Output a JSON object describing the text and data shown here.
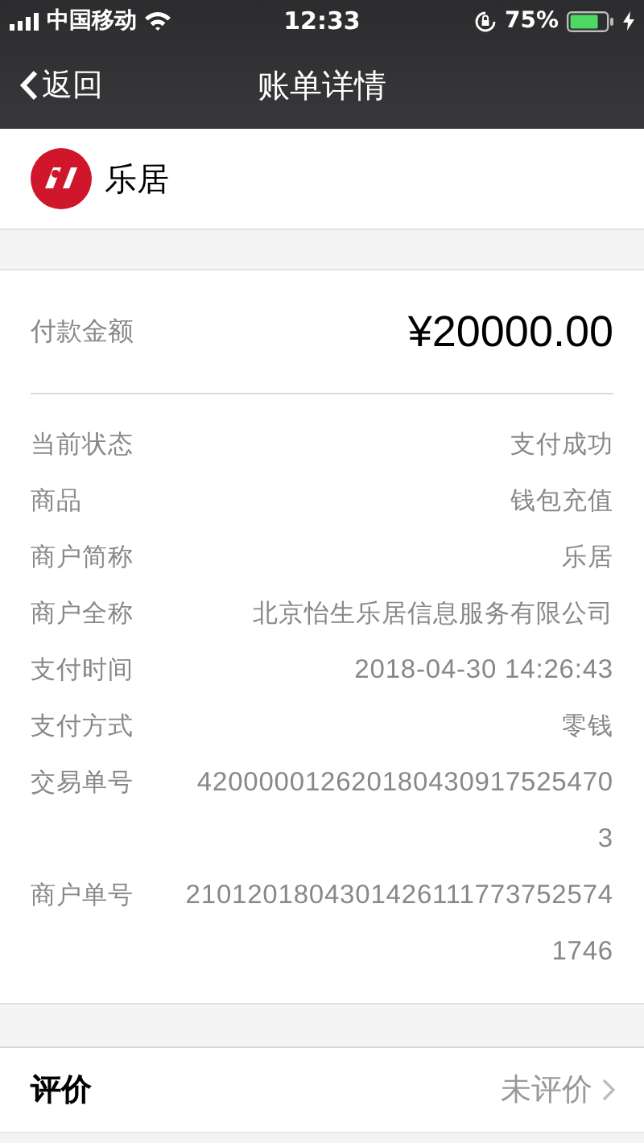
{
  "status_bar": {
    "carrier": "中国移动",
    "time": "12:33",
    "battery": "75%"
  },
  "nav": {
    "back": "返回",
    "title": "账单详情"
  },
  "merchant": {
    "name": "乐居"
  },
  "amount": {
    "label": "付款金额",
    "value": "¥20000.00"
  },
  "details": [
    {
      "label": "当前状态",
      "lines": [
        "支付成功"
      ]
    },
    {
      "label": "商品",
      "lines": [
        "钱包充值"
      ]
    },
    {
      "label": "商户简称",
      "lines": [
        "乐居"
      ]
    },
    {
      "label": "商户全称",
      "lines": [
        "北京怡生乐居信息服务有限公司"
      ]
    },
    {
      "label": "支付时间",
      "lines": [
        "2018-04-30 14:26:43"
      ]
    },
    {
      "label": "支付方式",
      "lines": [
        "零钱"
      ]
    },
    {
      "label": "交易单号",
      "lines": [
        "420000012620180430917525470",
        "3"
      ]
    },
    {
      "label": "商户单号",
      "lines": [
        "2101201804301426111773752574",
        "1746"
      ]
    }
  ],
  "review": {
    "label": "评价",
    "value": "未评价"
  }
}
